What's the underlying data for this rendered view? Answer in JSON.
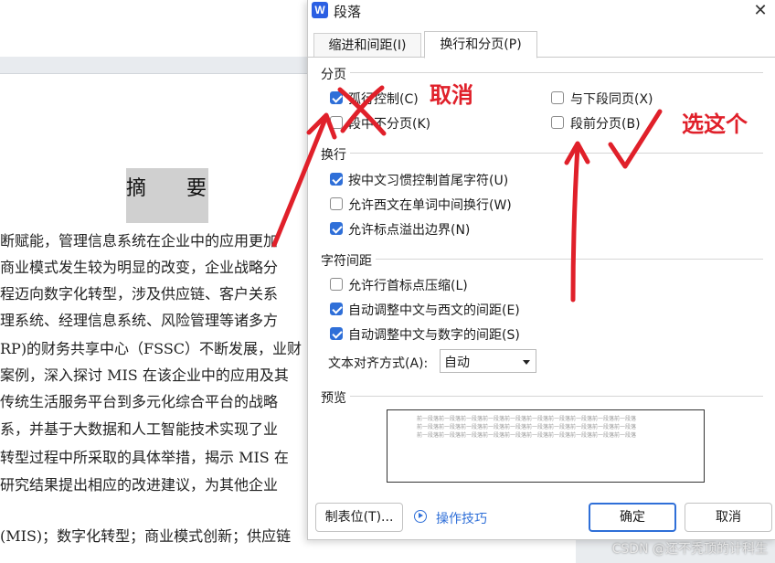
{
  "document": {
    "abstract_title": [
      "摘",
      "要"
    ],
    "lines": [
      "断赋能，管理信息系统在企业中的应用更加",
      "商业模式发生较为明显的改变，企业战略分",
      "程迈向数字化转型，涉及供应链、客户关系",
      "理系统、经理信息系统、风险管理等诸多方",
      "RP)的财务共享中心（FSSC）不断发展，业财",
      "案例，深入探讨 MIS 在该企业中的应用及其",
      "传统生活服务平台到多元化综合平台的战略",
      "系，并基于大数据和人工智能技术实现了业",
      "转型过程中所采取的具体举措，揭示 MIS 在",
      "研究结果提出相应的改进建议，为其他企业",
      "(MIS)；数字化转型；商业模式创新；供应链"
    ]
  },
  "dialog": {
    "app_icon": "W",
    "title": "段落",
    "close_icon": "close-icon",
    "tabs": [
      {
        "label": "缩进和间距(I)",
        "active": false
      },
      {
        "label": "换行和分页(P)",
        "active": true
      }
    ],
    "pagination": {
      "title": "分页",
      "options": [
        {
          "label": "孤行控制(C)",
          "checked": true
        },
        {
          "label": "段中不分页(K)",
          "checked": false
        },
        {
          "label": "与下段同页(X)",
          "checked": false
        },
        {
          "label": "段前分页(B)",
          "checked": false
        }
      ]
    },
    "line_break": {
      "title": "换行",
      "options": [
        {
          "label": "按中文习惯控制首尾字符(U)",
          "checked": true
        },
        {
          "label": "允许西文在单词中间换行(W)",
          "checked": false
        },
        {
          "label": "允许标点溢出边界(N)",
          "checked": true
        }
      ]
    },
    "char_spacing": {
      "title": "字符间距",
      "options": [
        {
          "label": "允许行首标点压缩(L)",
          "checked": false
        },
        {
          "label": "自动调整中文与西文的间距(E)",
          "checked": true
        },
        {
          "label": "自动调整中文与数字的间距(S)",
          "checked": true
        }
      ],
      "align_label": "文本对齐方式(A):",
      "align_value": "自动"
    },
    "preview": {
      "title": "预览",
      "sample": "前一段落前一段落前一段落前一段落前一段落前一段落前一段落前一段落前一段落前一段落"
    },
    "buttons": {
      "tabs": "制表位(T)...",
      "tips": "操作技巧",
      "ok": "确定",
      "cancel": "取消"
    }
  },
  "annotations": {
    "cancel_note": "取消",
    "choose_note": "选这个",
    "color": "#e0202a"
  },
  "watermark": "CSDN @还不秃顶的计科生"
}
